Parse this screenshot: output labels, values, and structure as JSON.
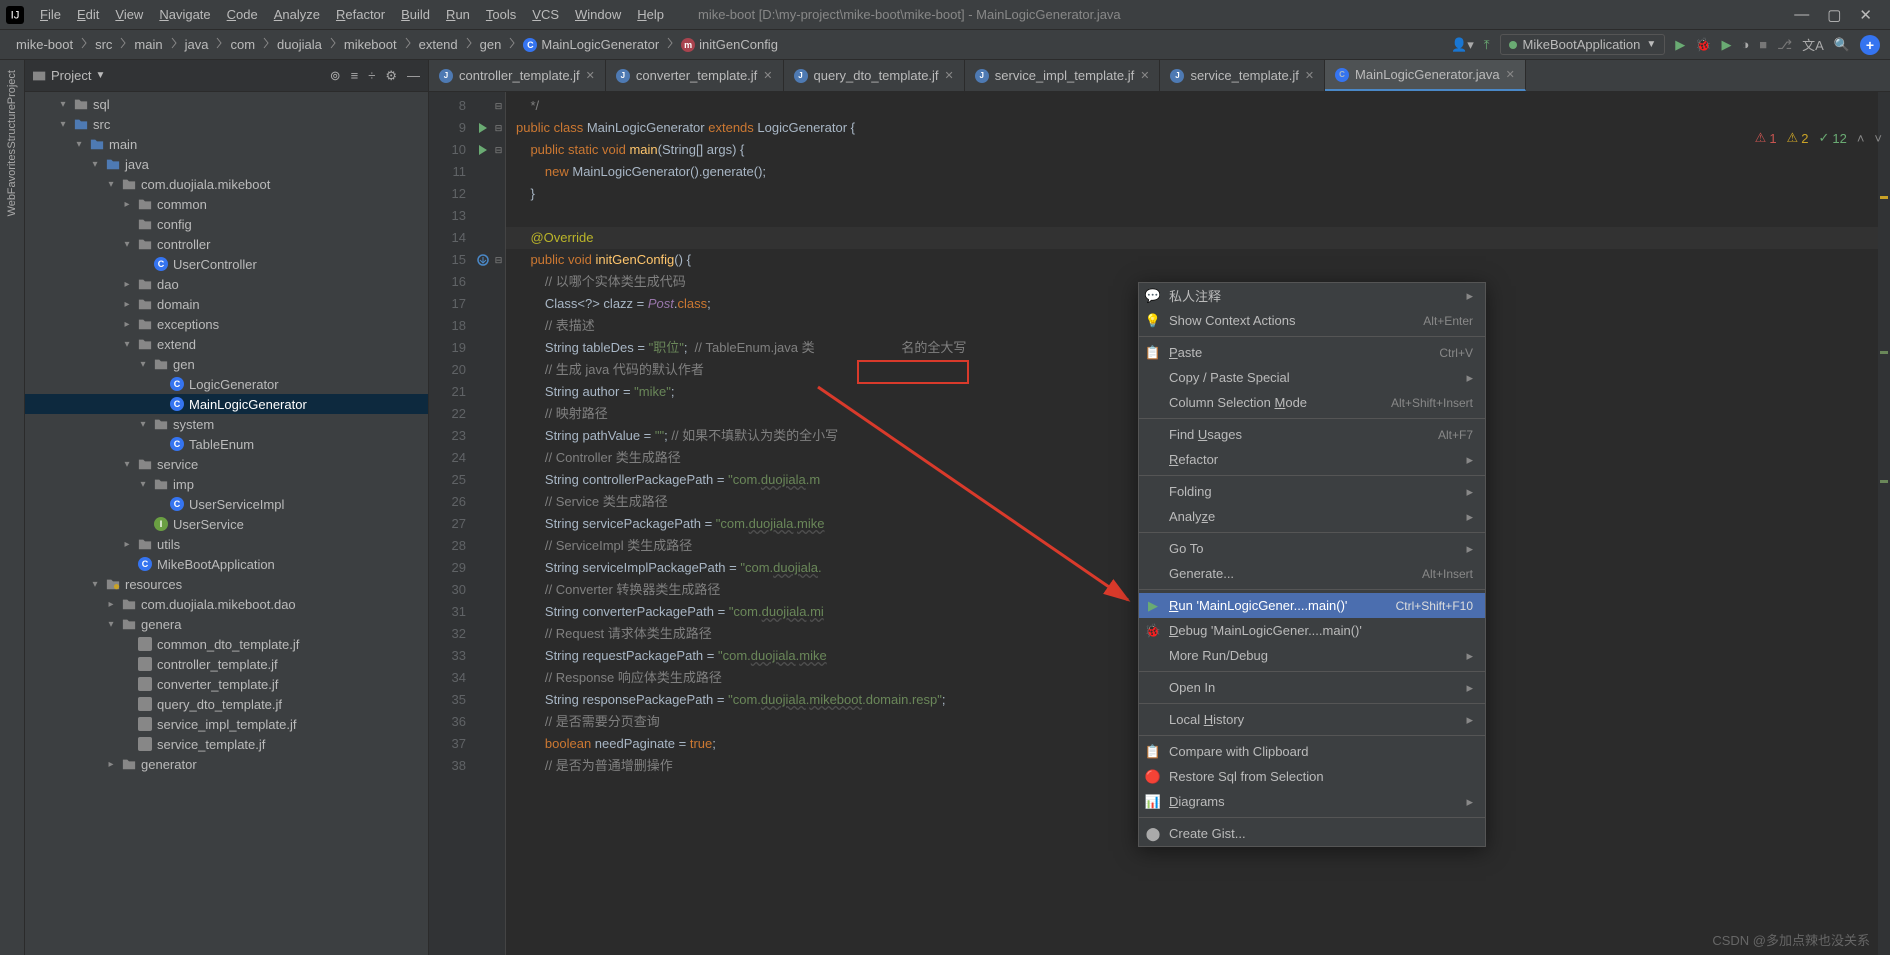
{
  "window_title": "mike-boot [D:\\my-project\\mike-boot\\mike-boot] - MainLogicGenerator.java",
  "menu": [
    "File",
    "Edit",
    "View",
    "Navigate",
    "Code",
    "Analyze",
    "Refactor",
    "Build",
    "Run",
    "Tools",
    "VCS",
    "Window",
    "Help"
  ],
  "breadcrumbs": [
    "mike-boot",
    "src",
    "main",
    "java",
    "com",
    "duojiala",
    "mikeboot",
    "extend",
    "gen",
    "MainLogicGenerator",
    "initGenConfig"
  ],
  "run_config": "MikeBootApplication",
  "project_label": "Project",
  "tree": [
    {
      "d": 2,
      "a": "▾",
      "i": "folder",
      "t": "sql"
    },
    {
      "d": 2,
      "a": "▾",
      "i": "folder-blue",
      "t": "src"
    },
    {
      "d": 3,
      "a": "▾",
      "i": "folder-blue",
      "t": "main"
    },
    {
      "d": 4,
      "a": "▾",
      "i": "folder-blue",
      "t": "java"
    },
    {
      "d": 5,
      "a": "▾",
      "i": "folder",
      "t": "com.duojiala.mikeboot"
    },
    {
      "d": 6,
      "a": "▸",
      "i": "folder",
      "t": "common"
    },
    {
      "d": 6,
      "a": "",
      "i": "folder",
      "t": "config"
    },
    {
      "d": 6,
      "a": "▾",
      "i": "folder",
      "t": "controller"
    },
    {
      "d": 7,
      "a": "",
      "i": "class",
      "t": "UserController"
    },
    {
      "d": 6,
      "a": "▸",
      "i": "folder",
      "t": "dao"
    },
    {
      "d": 6,
      "a": "▸",
      "i": "folder",
      "t": "domain"
    },
    {
      "d": 6,
      "a": "▸",
      "i": "folder",
      "t": "exceptions"
    },
    {
      "d": 6,
      "a": "▾",
      "i": "folder",
      "t": "extend"
    },
    {
      "d": 7,
      "a": "▾",
      "i": "folder",
      "t": "gen"
    },
    {
      "d": 8,
      "a": "",
      "i": "class",
      "t": "LogicGenerator"
    },
    {
      "d": 8,
      "a": "",
      "i": "class",
      "t": "MainLogicGenerator",
      "sel": true
    },
    {
      "d": 7,
      "a": "▾",
      "i": "folder",
      "t": "system"
    },
    {
      "d": 8,
      "a": "",
      "i": "class",
      "t": "TableEnum"
    },
    {
      "d": 6,
      "a": "▾",
      "i": "folder",
      "t": "service"
    },
    {
      "d": 7,
      "a": "▾",
      "i": "folder",
      "t": "imp"
    },
    {
      "d": 8,
      "a": "",
      "i": "class",
      "t": "UserServiceImpl"
    },
    {
      "d": 7,
      "a": "",
      "i": "int",
      "t": "UserService"
    },
    {
      "d": 6,
      "a": "▸",
      "i": "folder",
      "t": "utils"
    },
    {
      "d": 6,
      "a": "",
      "i": "class",
      "t": "MikeBootApplication"
    },
    {
      "d": 4,
      "a": "▾",
      "i": "folder-res",
      "t": "resources"
    },
    {
      "d": 5,
      "a": "▸",
      "i": "folder",
      "t": "com.duojiala.mikeboot.dao"
    },
    {
      "d": 5,
      "a": "▾",
      "i": "folder",
      "t": "genera"
    },
    {
      "d": 6,
      "a": "",
      "i": "file",
      "t": "common_dto_template.jf"
    },
    {
      "d": 6,
      "a": "",
      "i": "file",
      "t": "controller_template.jf"
    },
    {
      "d": 6,
      "a": "",
      "i": "file",
      "t": "converter_template.jf"
    },
    {
      "d": 6,
      "a": "",
      "i": "file",
      "t": "query_dto_template.jf"
    },
    {
      "d": 6,
      "a": "",
      "i": "file",
      "t": "service_impl_template.jf"
    },
    {
      "d": 6,
      "a": "",
      "i": "file",
      "t": "service_template.jf"
    },
    {
      "d": 5,
      "a": "▸",
      "i": "folder",
      "t": "generator"
    }
  ],
  "tabs": [
    {
      "ic": "J",
      "label": "controller_template.jf"
    },
    {
      "ic": "J",
      "label": "converter_template.jf"
    },
    {
      "ic": "J",
      "label": "query_dto_template.jf"
    },
    {
      "ic": "J",
      "label": "service_impl_template.jf"
    },
    {
      "ic": "J",
      "label": "service_template.jf"
    },
    {
      "ic": "C",
      "label": "MainLogicGenerator.java",
      "active": true
    }
  ],
  "inspections": {
    "err": "1",
    "warn": "2",
    "weak": "12"
  },
  "line_start": 8,
  "line_end": 38,
  "gutter": {
    "9": "run",
    "10": "run",
    "15": "override"
  },
  "code_lines": [
    {
      "n": 8,
      "html": "    <span class='cmt'>*/</span>"
    },
    {
      "n": 9,
      "html": "<span class='kw'>public class</span> <span class='cls'>MainLogicGenerator</span> <span class='kw'>extends</span> <span class='cls'>LogicGenerator</span> {"
    },
    {
      "n": 10,
      "html": "    <span class='kw'>public static void</span> <span class='fn'>main</span>(String[] args) {"
    },
    {
      "n": 11,
      "html": "        <span class='kw'>new</span> MainLogicGenerator().generate();"
    },
    {
      "n": 12,
      "html": "    }"
    },
    {
      "n": 13,
      "html": ""
    },
    {
      "n": 14,
      "html": "    <span class='ann'>@Override</span>",
      "cur": true
    },
    {
      "n": 15,
      "html": "    <span class='kw'>public void</span> <span class='fn'>initGenConfig</span>() {"
    },
    {
      "n": 16,
      "html": "        <span class='cmt'>// 以哪个实体类生成代码</span>"
    },
    {
      "n": 17,
      "html": "        Class&lt;?&gt; clazz = <span class='id'>Post</span>.<span class='kw'>class</span>;"
    },
    {
      "n": 18,
      "html": "        <span class='cmt'>// 表描述</span>"
    },
    {
      "n": 19,
      "html": "        String tableDes = <span class='str'>\"职位\"</span>;  <span class='cmt'>// TableEnum.java 类</span>                        <span class='cmt'>名的全大写</span>"
    },
    {
      "n": 20,
      "html": "        <span class='cmt'>// 生成 java 代码的默认作者</span>"
    },
    {
      "n": 21,
      "html": "        String author = <span class='str'>\"mike\"</span>;"
    },
    {
      "n": 22,
      "html": "        <span class='cmt'>// 映射路径</span>"
    },
    {
      "n": 23,
      "html": "        String pathValue = <span class='str'>\"\"</span>; <span class='cmt'>// 如果不填默认为类的全小写</span>"
    },
    {
      "n": 24,
      "html": "        <span class='cmt'>// Controller 类生成路径</span>"
    },
    {
      "n": 25,
      "html": "        String controllerPackagePath = <span class='str'>\"com.<span class='pkg'>duojiala</span>.m</span>"
    },
    {
      "n": 26,
      "html": "        <span class='cmt'>// Service 类生成路径</span>"
    },
    {
      "n": 27,
      "html": "        String servicePackagePath = <span class='str'>\"com.<span class='pkg'>duojiala</span>.<span class='pkg'>mike</span></span>"
    },
    {
      "n": 28,
      "html": "        <span class='cmt'>// ServiceImpl 类生成路径</span>"
    },
    {
      "n": 29,
      "html": "        String serviceImplPackagePath = <span class='str'>\"com.<span class='pkg'>duojiala</span>.</span>"
    },
    {
      "n": 30,
      "html": "        <span class='cmt'>// Converter 转换器类生成路径</span>"
    },
    {
      "n": 31,
      "html": "        String converterPackagePath = <span class='str'>\"com.<span class='pkg'>duojiala</span>.<span class='pkg'>mi</span></span>"
    },
    {
      "n": 32,
      "html": "        <span class='cmt'>// Request 请求体类生成路径</span>"
    },
    {
      "n": 33,
      "html": "        String requestPackagePath = <span class='str'>\"com.<span class='pkg'>duojiala</span>.<span class='pkg'>mike</span></span>"
    },
    {
      "n": 34,
      "html": "        <span class='cmt'>// Response 响应体类生成路径</span>"
    },
    {
      "n": 35,
      "html": "        String responsePackagePath = <span class='str'>\"com.<span class='pkg'>duojiala</span>.<span class='pkg'>mikeboot</span>.domain.resp\"</span>;"
    },
    {
      "n": 36,
      "html": "        <span class='cmt'>// 是否需要分页查询</span>"
    },
    {
      "n": 37,
      "html": "        <span class='kw'>boolean</span> needPaginate = <span class='kw'>true</span>;"
    },
    {
      "n": 38,
      "html": "        <span class='cmt'>// 是否为普通增删操作</span>"
    }
  ],
  "context_menu": [
    {
      "icon": "💬",
      "label": "私人注释",
      "sub": "▸"
    },
    {
      "icon": "💡",
      "label": "Show Context Actions",
      "sc": "Alt+Enter"
    },
    {
      "sep": true
    },
    {
      "icon": "📋",
      "label": "Paste",
      "u": "P",
      "sc": "Ctrl+V"
    },
    {
      "label": "Copy / Paste Special",
      "sub": "▸"
    },
    {
      "label": "Column Selection Mode",
      "u": "M",
      "sc": "Alt+Shift+Insert"
    },
    {
      "sep": true
    },
    {
      "label": "Find Usages",
      "u": "U",
      "sc": "Alt+F7"
    },
    {
      "label": "Refactor",
      "u": "R",
      "sub": "▸"
    },
    {
      "sep": true
    },
    {
      "label": "Folding",
      "sub": "▸"
    },
    {
      "label": "Analyze",
      "u": "z",
      "sub": "▸"
    },
    {
      "sep": true
    },
    {
      "label": "Go To",
      "sub": "▸"
    },
    {
      "label": "Generate...",
      "sc": "Alt+Insert"
    },
    {
      "sep": true
    },
    {
      "icon": "▶",
      "iconColor": "#6aab73",
      "label": "Run 'MainLogicGener....main()'",
      "u": "R",
      "sc": "Ctrl+Shift+F10",
      "hov": true
    },
    {
      "icon": "🐞",
      "iconColor": "#6aab73",
      "label": "Debug 'MainLogicGener....main()'",
      "u": "D"
    },
    {
      "label": "More Run/Debug",
      "sub": "▸"
    },
    {
      "sep": true
    },
    {
      "label": "Open In",
      "sub": "▸"
    },
    {
      "sep": true
    },
    {
      "label": "Local History",
      "u": "H",
      "sub": "▸"
    },
    {
      "sep": true
    },
    {
      "icon": "📋",
      "label": "Compare with Clipboard"
    },
    {
      "icon": "🔴",
      "label": "Restore Sql from Selection"
    },
    {
      "icon": "📊",
      "label": "Diagrams",
      "u": "D",
      "sub": "▸"
    },
    {
      "sep": true
    },
    {
      "icon": "⬤",
      "label": "Create Gist..."
    }
  ],
  "left_tabs": [
    "Project",
    "Structure",
    "Favorites",
    "Web"
  ],
  "watermark": "CSDN @多加点辣也没关系"
}
